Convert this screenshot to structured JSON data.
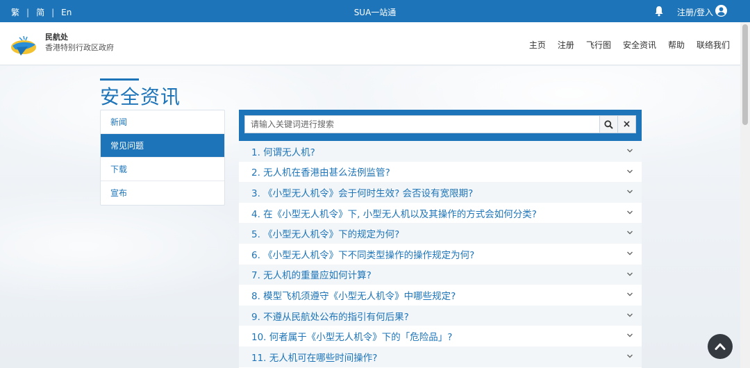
{
  "topbar": {
    "languages": [
      "繁",
      "简",
      "En"
    ],
    "separator": "|",
    "site_title": "SUA一站通",
    "login_label": "注册/登入"
  },
  "header": {
    "org_name": "民航处",
    "org_sub": "香港特别行政区政府",
    "nav": [
      "主页",
      "注册",
      "飞行图",
      "安全资讯",
      "帮助",
      "联络我们"
    ]
  },
  "page": {
    "title": "安全资讯"
  },
  "sidebar": {
    "items": [
      {
        "label": "新闻",
        "active": false
      },
      {
        "label": "常见问题",
        "active": true
      },
      {
        "label": "下载",
        "active": false
      },
      {
        "label": "宣布",
        "active": false
      }
    ]
  },
  "search": {
    "placeholder": "请输入关键词进行搜索",
    "value": "",
    "clear_label": "×"
  },
  "faq": [
    "1. 何谓无人机?",
    "2. 无人机在香港由甚么法例监管?",
    "3. 《小型无人机令》会于何时生效? 会否设有宽限期?",
    "4. 在《小型无人机令》下, 小型无人机以及其操作的方式会如何分类?",
    "5. 《小型无人机令》下的规定为何?",
    "6. 《小型无人机令》下不同类型操作的操作规定为何?",
    "7. 无人机的重量应如何计算?",
    "8. 模型飞机须遵守《小型无人机令》中哪些规定?",
    "9. 不遵从民航处公布的指引有何后果?",
    "10. 何者属于《小型无人机令》下的「危险品」?",
    "11. 无人机可在哪些时间操作?"
  ],
  "colors": {
    "brand": "#1d74b8",
    "dark_button": "#343a40"
  },
  "icons": {
    "bell": "bell-icon",
    "user": "user-circle-icon",
    "search": "search-icon",
    "clear": "close-icon",
    "chevron": "chevron-down-icon",
    "to_top": "chevron-up-icon"
  }
}
